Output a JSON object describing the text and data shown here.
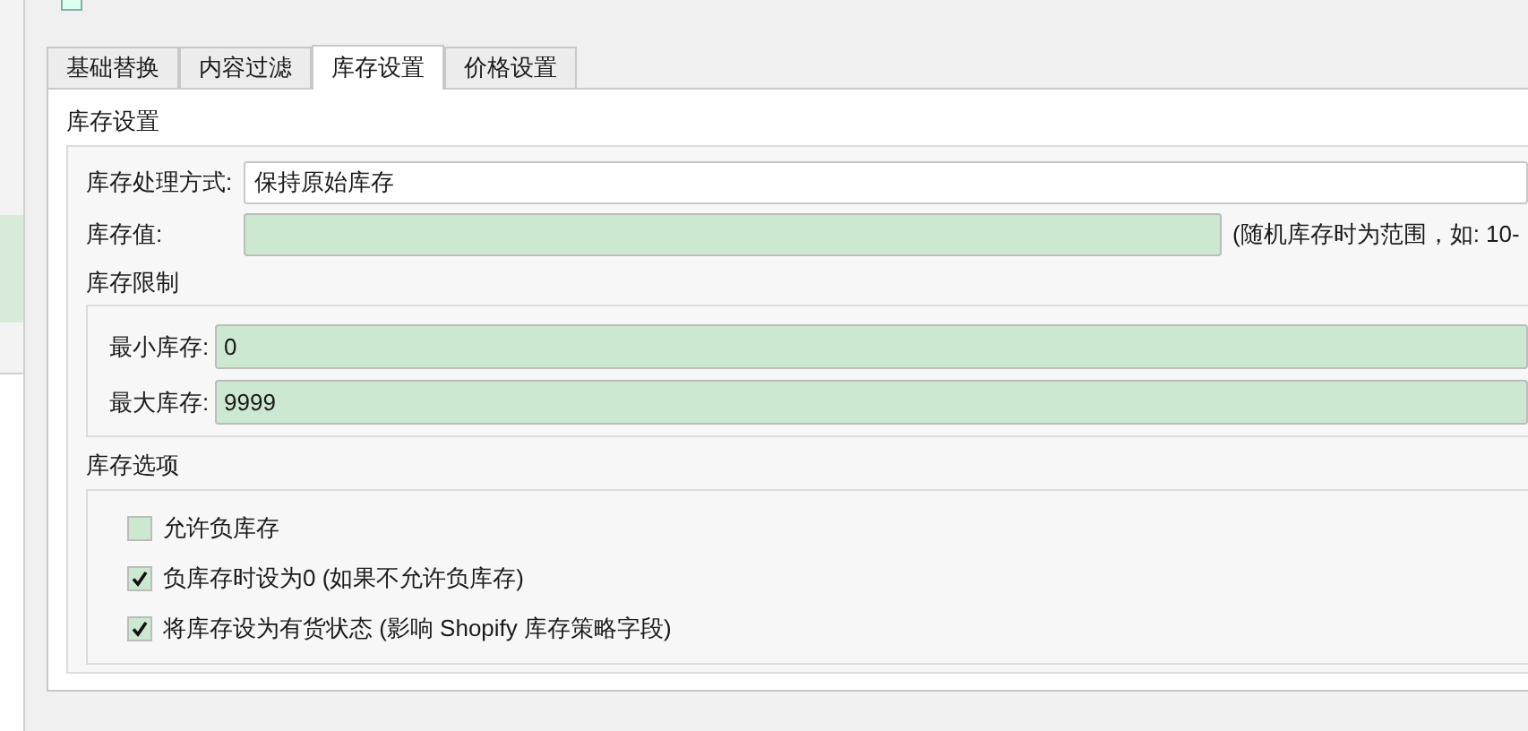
{
  "tabs": [
    {
      "label": "基础替换",
      "selected": false
    },
    {
      "label": "内容过滤",
      "selected": false
    },
    {
      "label": "库存设置",
      "selected": true
    },
    {
      "label": "价格设置",
      "selected": false
    }
  ],
  "section_title": "库存设置",
  "mode": {
    "label": "库存处理方式:",
    "value": "保持原始库存"
  },
  "stock_value": {
    "label": "库存值:",
    "hint": "(随机库存时为范围，如: 10-"
  },
  "limits": {
    "title": "库存限制",
    "fields": [
      {
        "label": "最小库存:",
        "value": "0"
      },
      {
        "label": "最大库存:",
        "value": "9999"
      }
    ]
  },
  "options": {
    "title": "库存选项",
    "items": [
      {
        "label": "允许负库存",
        "checked": false
      },
      {
        "label": "负库存时设为0 (如果不允许负库存)",
        "checked": true
      },
      {
        "label": "将库存设为有货状态 (影响 Shopify 库存策略字段)",
        "checked": true
      }
    ]
  }
}
